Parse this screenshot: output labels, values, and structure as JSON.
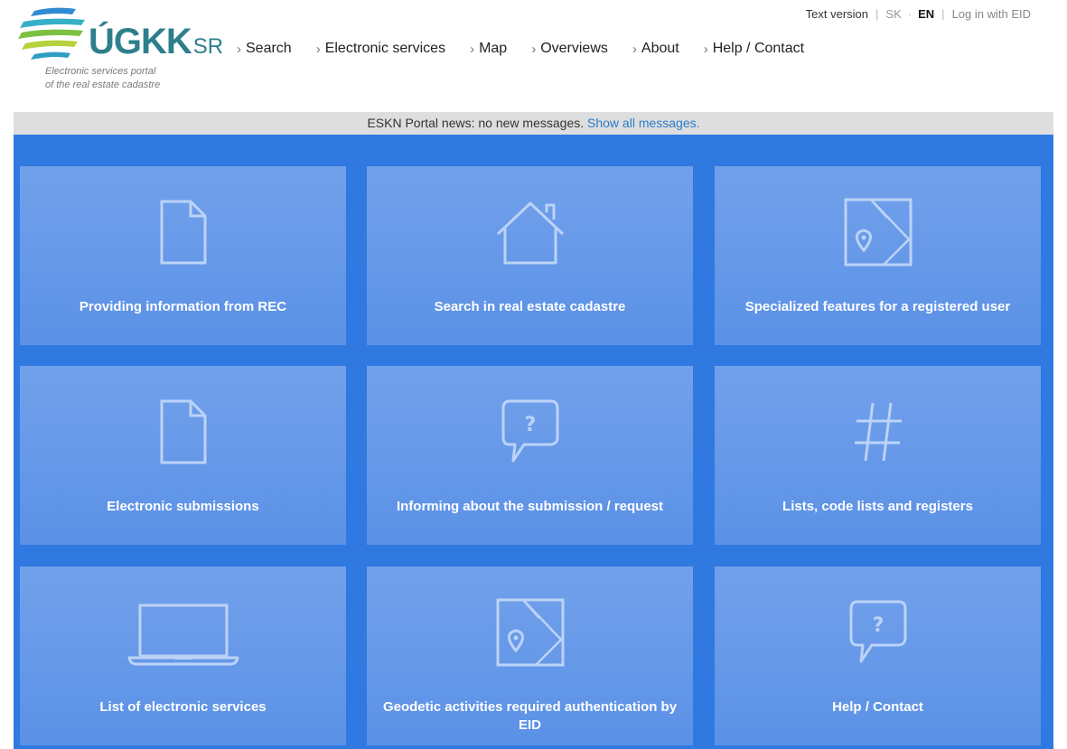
{
  "header": {
    "logo": {
      "name": "ÚGKK",
      "suffix": "SR",
      "tagline_line1": "Electronic services portal",
      "tagline_line2": "of the real estate cadastre"
    },
    "topbar": {
      "text_version": "Text version",
      "lang_sk": "SK",
      "lang_en": "EN",
      "login": "Log in with EID"
    },
    "nav": [
      {
        "label": "Search"
      },
      {
        "label": "Electronic services"
      },
      {
        "label": "Map"
      },
      {
        "label": "Overviews"
      },
      {
        "label": "About"
      },
      {
        "label": "Help / Contact"
      }
    ]
  },
  "news": {
    "text": "ESKN Portal news: no new messages.",
    "link": "Show all messages."
  },
  "tiles": [
    {
      "label": "Providing information from REC",
      "icon": "document-icon"
    },
    {
      "label": "Search in real estate cadastre",
      "icon": "house-icon"
    },
    {
      "label": "Specialized features for a registered user",
      "icon": "map-pin-icon"
    },
    {
      "label": "Electronic submissions",
      "icon": "document-icon"
    },
    {
      "label": "Informing about the submission / request",
      "icon": "question-bubble-icon"
    },
    {
      "label": "Lists, code lists and registers",
      "icon": "hash-icon"
    },
    {
      "label": "List of electronic services",
      "icon": "laptop-icon"
    },
    {
      "label": "Geodetic activities required authentication by EID",
      "icon": "map-pin-icon"
    },
    {
      "label": "Help / Contact",
      "icon": "question-bubble-icon"
    }
  ],
  "colors": {
    "main_bg": "#2f79e1",
    "tile_bg": "#6a9cea",
    "link": "#2b7bc9",
    "logo": "#2e7f8c"
  }
}
